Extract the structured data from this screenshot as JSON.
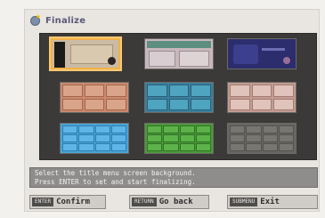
{
  "header": {
    "title": "Finalize",
    "icon": "disc-star-icon"
  },
  "thumbnails": [
    {
      "id": "bg-1",
      "selected": true
    },
    {
      "id": "bg-2",
      "selected": false
    },
    {
      "id": "bg-3",
      "selected": false
    },
    {
      "id": "bg-4",
      "selected": false
    },
    {
      "id": "bg-5",
      "selected": false
    },
    {
      "id": "bg-6",
      "selected": false
    },
    {
      "id": "bg-7",
      "selected": false
    },
    {
      "id": "bg-8",
      "selected": false
    },
    {
      "id": "bg-9",
      "selected": false
    }
  ],
  "message": {
    "line1": "Select the title menu screen background.",
    "line2": "Press ENTER to set and start finalizing."
  },
  "buttons": {
    "confirm": {
      "key": "ENTER",
      "label": "Confirm"
    },
    "go_back": {
      "key": "RETURN",
      "label": "Go back"
    },
    "exit": {
      "key": "SUBMENU",
      "label": "Exit"
    }
  },
  "colors": {
    "selection": "#f2b14a",
    "grid_background": "#3b3a38",
    "message_background": "#8f8d8b"
  }
}
